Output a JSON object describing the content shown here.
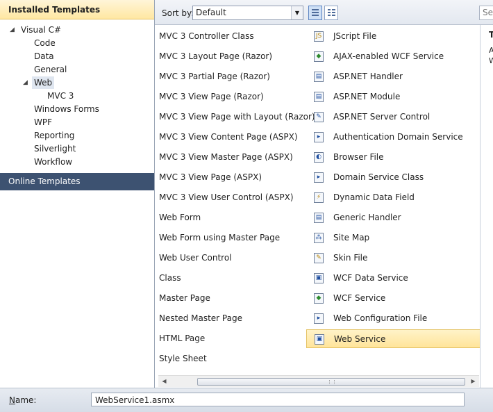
{
  "left_panel": {
    "installed_header": "Installed Templates",
    "online_header": "Online Templates",
    "tree": [
      {
        "label": "Visual C#",
        "level": 0,
        "expanded": true,
        "selected": false
      },
      {
        "label": "Code",
        "level": 1,
        "expanded": false,
        "selected": false
      },
      {
        "label": "Data",
        "level": 1,
        "expanded": false,
        "selected": false
      },
      {
        "label": "General",
        "level": 1,
        "expanded": false,
        "selected": false
      },
      {
        "label": "Web",
        "level": 1,
        "expanded": true,
        "selected": true
      },
      {
        "label": "MVC 3",
        "level": 2,
        "expanded": false,
        "selected": false
      },
      {
        "label": "Windows Forms",
        "level": 1,
        "expanded": false,
        "selected": false
      },
      {
        "label": "WPF",
        "level": 1,
        "expanded": false,
        "selected": false
      },
      {
        "label": "Reporting",
        "level": 1,
        "expanded": false,
        "selected": false
      },
      {
        "label": "Silverlight",
        "level": 1,
        "expanded": false,
        "selected": false
      },
      {
        "label": "Workflow",
        "level": 1,
        "expanded": false,
        "selected": false
      }
    ]
  },
  "toolbar": {
    "sort_label": "Sort by:",
    "sort_value": "Default",
    "search_placeholder": "Se"
  },
  "templates": {
    "column1": [
      "MVC 3 Controller Class",
      "MVC 3 Layout Page (Razor)",
      "MVC 3 Partial Page (Razor)",
      "MVC 3 View Page (Razor)",
      "MVC 3 View Page with Layout (Razor)",
      "MVC 3 View Content Page (ASPX)",
      "MVC 3 View Master Page (ASPX)",
      "MVC 3 View Page (ASPX)",
      "MVC 3 View User Control (ASPX)",
      "Web Form",
      "Web Form using Master Page",
      "Web User Control",
      "Class",
      "Master Page",
      "Nested Master Page",
      "HTML Page",
      "Style Sheet"
    ],
    "column2": [
      {
        "label": "JScript File",
        "icon": "script-file-icon",
        "glyph": "JS",
        "tone": "gold",
        "selected": false
      },
      {
        "label": "AJAX-enabled WCF Service",
        "icon": "wcf-service-icon",
        "glyph": "◆",
        "tone": "green",
        "selected": false
      },
      {
        "label": "ASP.NET Handler",
        "icon": "handler-icon",
        "glyph": "▤",
        "tone": "blue",
        "selected": false
      },
      {
        "label": "ASP.NET Module",
        "icon": "module-icon",
        "glyph": "▤",
        "tone": "blue",
        "selected": false
      },
      {
        "label": "ASP.NET Server Control",
        "icon": "server-control-icon",
        "glyph": "✎",
        "tone": "blue",
        "selected": false
      },
      {
        "label": "Authentication Domain Service",
        "icon": "domain-service-icon",
        "glyph": "▸",
        "tone": "blue",
        "selected": false
      },
      {
        "label": "Browser File",
        "icon": "browser-file-icon",
        "glyph": "◐",
        "tone": "blue",
        "selected": false
      },
      {
        "label": "Domain Service Class",
        "icon": "domain-class-icon",
        "glyph": "▸",
        "tone": "blue",
        "selected": false
      },
      {
        "label": "Dynamic Data Field",
        "icon": "dynamic-data-icon",
        "glyph": "⚡",
        "tone": "gold",
        "selected": false
      },
      {
        "label": "Generic Handler",
        "icon": "generic-handler-icon",
        "glyph": "▤",
        "tone": "blue",
        "selected": false
      },
      {
        "label": "Site Map",
        "icon": "site-map-icon",
        "glyph": "⁂",
        "tone": "blue",
        "selected": false
      },
      {
        "label": "Skin File",
        "icon": "skin-file-icon",
        "glyph": "✎",
        "tone": "gold",
        "selected": false
      },
      {
        "label": "WCF Data Service",
        "icon": "wcf-data-service-icon",
        "glyph": "▣",
        "tone": "blue",
        "selected": false
      },
      {
        "label": "WCF Service",
        "icon": "wcf-service-icon",
        "glyph": "◆",
        "tone": "green",
        "selected": false
      },
      {
        "label": "Web Configuration File",
        "icon": "config-file-icon",
        "glyph": "▸",
        "tone": "blue",
        "selected": false
      },
      {
        "label": "Web Service",
        "icon": "web-service-icon",
        "glyph": "▣",
        "tone": "blue",
        "selected": true
      }
    ]
  },
  "right_panel": {
    "title": "T",
    "line1": "A",
    "line2": "W"
  },
  "name_bar": {
    "label_underlined": "N",
    "label_rest": "ame:",
    "value": "WebService1.asmx"
  }
}
